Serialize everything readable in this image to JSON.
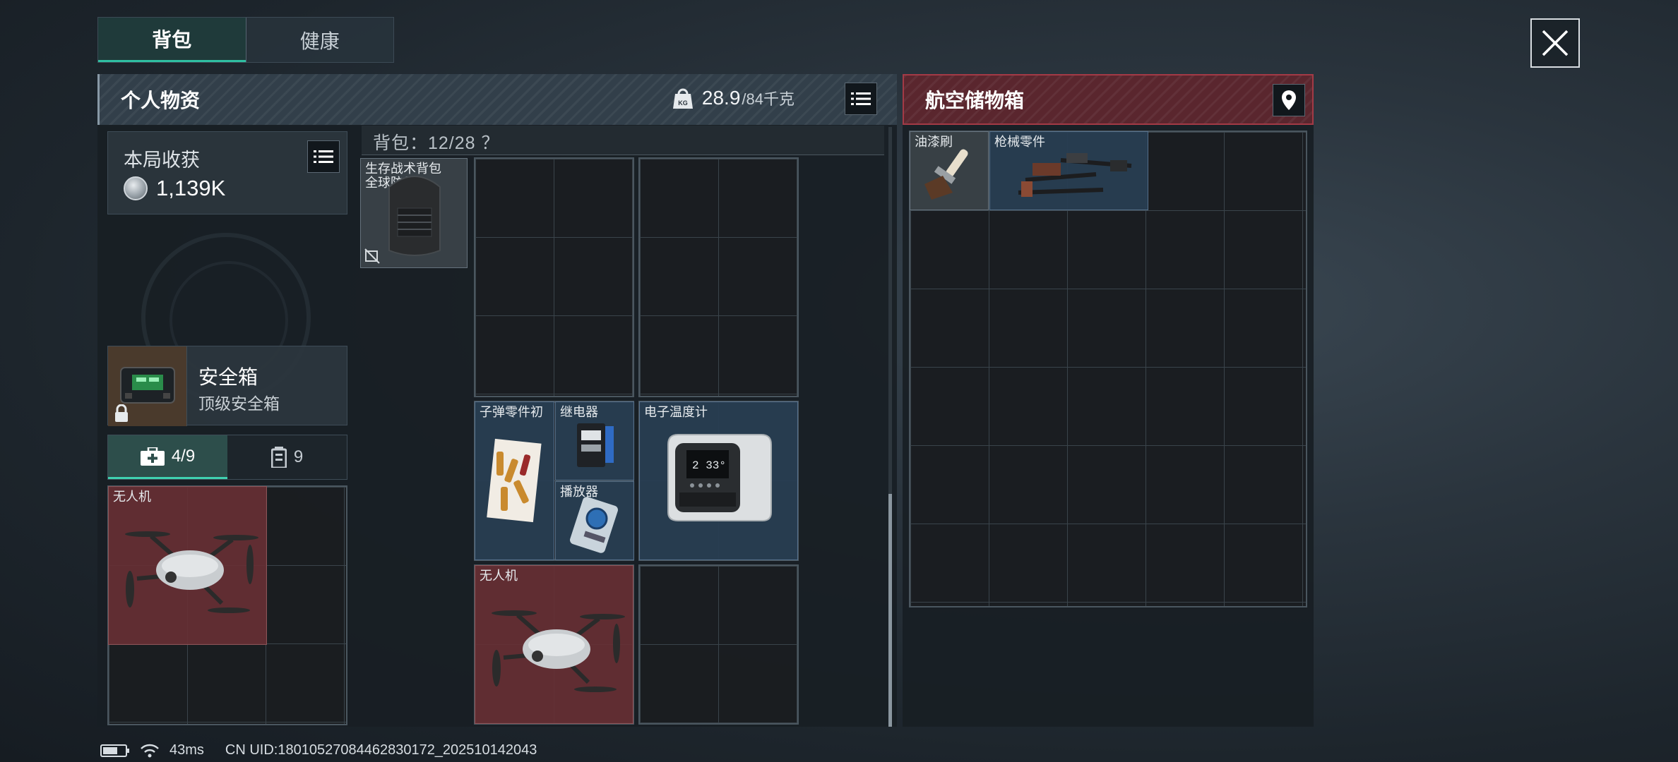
{
  "tabs": [
    {
      "label": "背包"
    },
    {
      "label": "健康"
    }
  ],
  "personal": {
    "title": "个人物资",
    "weight_current": "28.9",
    "weight_capacity": "/84千克",
    "weight_badge": "KG"
  },
  "harvest": {
    "label": "本局收获",
    "value": "1,139K"
  },
  "safebox": {
    "name": "安全箱",
    "subtitle": "顶级安全箱"
  },
  "subtabs": [
    {
      "label": "4/9"
    },
    {
      "label": "9"
    }
  ],
  "backpack": {
    "caption": "背包：12/28 ？"
  },
  "items": {
    "left_drone": "无人机",
    "backpack_item_line1": "生存战术背包",
    "backpack_item_line2": "全球防具",
    "ammo_parts": "子弹零件初",
    "relay": "继电器",
    "player": "播放器",
    "thermometer": "电子温度计",
    "drone": "无人机",
    "thermometer_display": "2 33°"
  },
  "air": {
    "title": "航空储物箱",
    "items": {
      "brush": "油漆刷",
      "gun_parts": "枪械零件"
    }
  },
  "status": {
    "ping": "43ms",
    "uid": "CN UID:18010527084462830172_202510142043"
  },
  "colors": {
    "accent_teal": "#2fbfa2",
    "air_red": "#a33a46",
    "item_red": "#683034",
    "item_blue": "#283e52"
  },
  "icons": [
    "weight-icon",
    "list-icon",
    "close-icon",
    "coin-icon",
    "lock-icon",
    "location-pin-icon",
    "medkit-icon",
    "canister-icon",
    "battery-icon",
    "wifi-icon",
    "no-trade-icon"
  ]
}
